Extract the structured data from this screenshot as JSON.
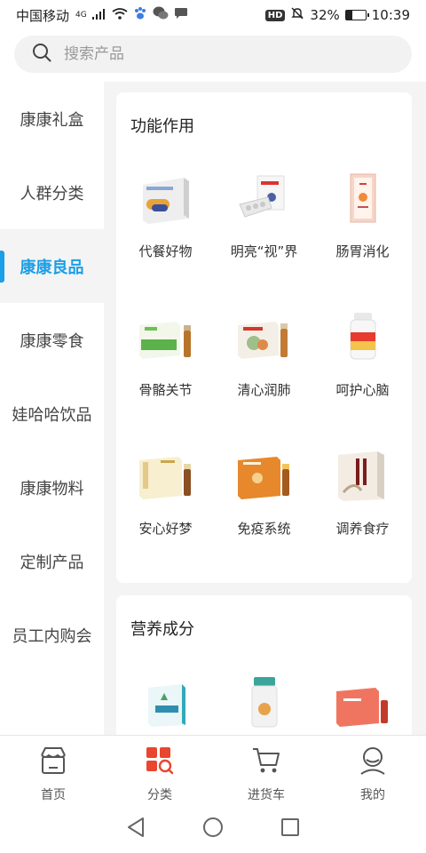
{
  "status_bar": {
    "carrier": "中国移动",
    "network": "4G",
    "hd": "HD",
    "battery": "32%",
    "battery_level": 0.32,
    "time": "10:39"
  },
  "search": {
    "placeholder": "搜索产品"
  },
  "sidebar": {
    "items": [
      {
        "label": "康康礼盒",
        "active": false
      },
      {
        "label": "人群分类",
        "active": false
      },
      {
        "label": "康康良品",
        "active": true
      },
      {
        "label": "康康零食",
        "active": false
      },
      {
        "label": "娃哈哈饮品",
        "active": false
      },
      {
        "label": "康康物料",
        "active": false
      },
      {
        "label": "定制产品",
        "active": false
      },
      {
        "label": "员工内购会",
        "active": false
      }
    ]
  },
  "main": {
    "sections": [
      {
        "title": "功能作用",
        "items": [
          {
            "label": "代餐好物"
          },
          {
            "label": "明亮“视”界"
          },
          {
            "label": "肠胃消化"
          },
          {
            "label": "骨骼关节"
          },
          {
            "label": "清心润肺"
          },
          {
            "label": "呵护心脑"
          },
          {
            "label": "安心好梦"
          },
          {
            "label": "免疫系统"
          },
          {
            "label": "调养食疗"
          }
        ]
      },
      {
        "title": "营养成分",
        "items": [
          {
            "label": ""
          },
          {
            "label": ""
          },
          {
            "label": ""
          }
        ]
      }
    ]
  },
  "bottom_nav": {
    "items": [
      {
        "label": "首页",
        "icon": "store-icon",
        "active": false
      },
      {
        "label": "分类",
        "icon": "category-icon",
        "active": true
      },
      {
        "label": "进货车",
        "icon": "cart-icon",
        "active": false
      },
      {
        "label": "我的",
        "icon": "user-icon",
        "active": false
      }
    ]
  },
  "colors": {
    "accent": "#1a9fe8",
    "category_red": "#e8462e",
    "page_bg": "#f4f4f4"
  }
}
